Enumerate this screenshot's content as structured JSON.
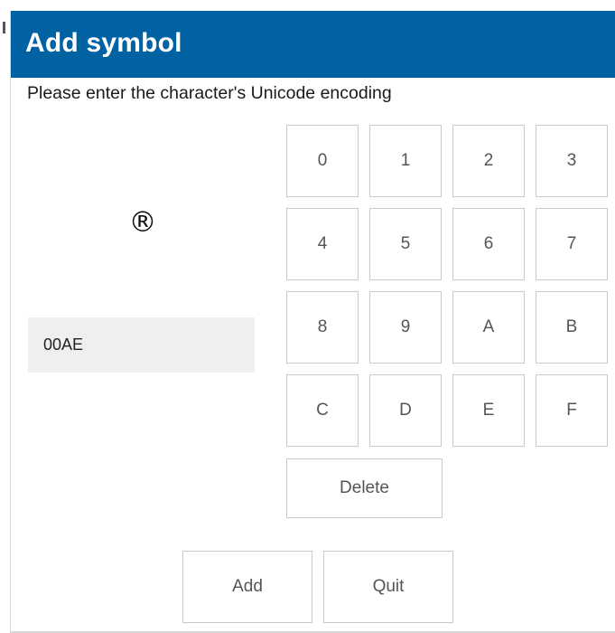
{
  "dialog": {
    "title": "Add symbol",
    "prompt": "Please enter the character's Unicode encoding",
    "preview_symbol": "®",
    "code_value": "00AE",
    "accent_color": "#0062a3"
  },
  "keypad": {
    "keys": [
      "0",
      "1",
      "2",
      "3",
      "4",
      "5",
      "6",
      "7",
      "8",
      "9",
      "A",
      "B",
      "C",
      "D",
      "E",
      "F"
    ],
    "delete_label": "Delete"
  },
  "actions": {
    "add_label": "Add",
    "quit_label": "Quit"
  }
}
